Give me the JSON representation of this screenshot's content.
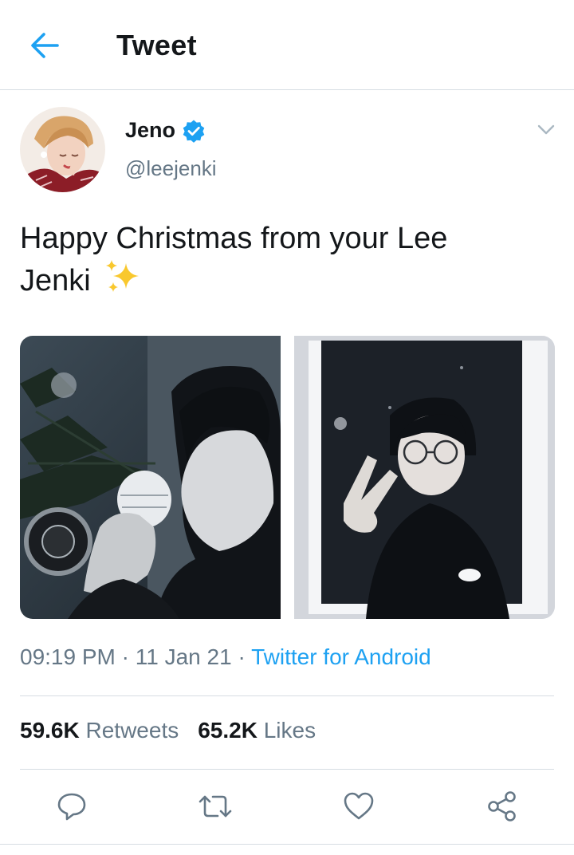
{
  "header": {
    "title": "Tweet",
    "back_icon": "arrow-left-icon"
  },
  "author": {
    "name": "Jeno",
    "handle": "@leejenki",
    "verified": true,
    "avatar_icon": "avatar"
  },
  "tweet": {
    "text_line1": "Happy Christmas from your Lee",
    "text_line2": "Jenki",
    "emoji": "sparkles-icon",
    "photos": [
      {
        "icon": "photo-christmas-ornament"
      },
      {
        "icon": "photo-peace-sign-polaroid"
      }
    ]
  },
  "meta": {
    "time": "09:19 PM",
    "date": "11 Jan 21",
    "separator": "·",
    "source": "Twitter for Android"
  },
  "stats": {
    "retweets_count": "59.6K",
    "retweets_label": "Retweets",
    "likes_count": "65.2K",
    "likes_label": "Likes"
  },
  "actions": [
    "reply-icon",
    "retweet-icon",
    "like-icon",
    "share-icon"
  ],
  "colors": {
    "accent": "#1da1f2",
    "text": "#14171a",
    "muted": "#657786",
    "divider": "#d6dde3"
  }
}
